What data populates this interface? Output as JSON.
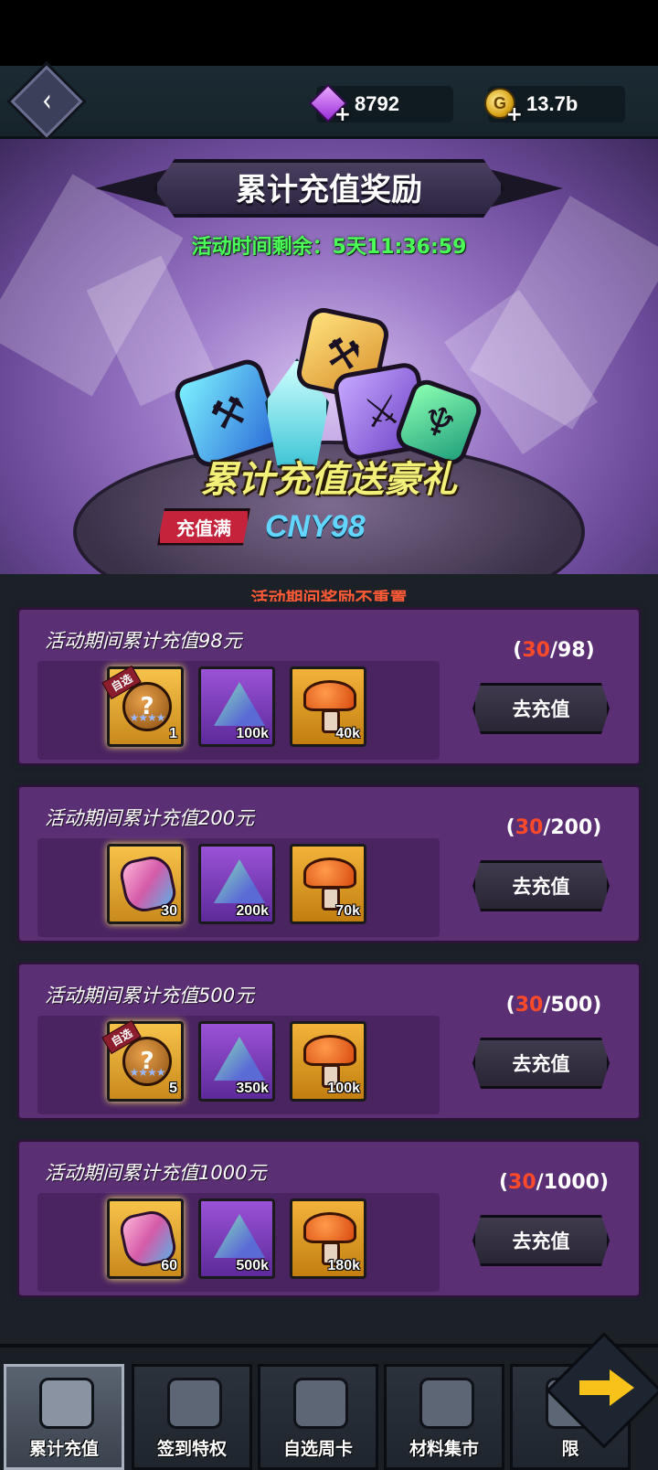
{
  "currencies": {
    "gems": "8792",
    "gold": "13.7b",
    "gold_symbol": "G"
  },
  "banner": {
    "title": "累计充值奖励",
    "countdown_label": "活动时间剩余：",
    "countdown_value": "5天11:36:59",
    "promo": "累计充值送豪礼",
    "threshold_tag": "充值满",
    "threshold_value": "CNY98"
  },
  "notice": "活动期间奖励不重置",
  "tiers": [
    {
      "title": "活动期间累计充值98元",
      "progress_current": "30",
      "progress_target": "/98",
      "button": "去充值",
      "rewards": [
        {
          "type": "chest",
          "qty": "1",
          "selectable": "自选",
          "stars": "★★★★"
        },
        {
          "type": "powder",
          "qty": "100k"
        },
        {
          "type": "mushroom",
          "qty": "40k"
        }
      ]
    },
    {
      "title": "活动期间累计充值200元",
      "progress_current": "30",
      "progress_target": "/200",
      "button": "去充值",
      "rewards": [
        {
          "type": "fist",
          "qty": "30"
        },
        {
          "type": "powder",
          "qty": "200k"
        },
        {
          "type": "mushroom",
          "qty": "70k"
        }
      ]
    },
    {
      "title": "活动期间累计充值500元",
      "progress_current": "30",
      "progress_target": "/500",
      "button": "去充值",
      "rewards": [
        {
          "type": "chest",
          "qty": "5",
          "selectable": "自选",
          "stars": "★★★★"
        },
        {
          "type": "powder",
          "qty": "350k"
        },
        {
          "type": "mushroom",
          "qty": "100k"
        }
      ]
    },
    {
      "title": "活动期间累计充值1000元",
      "progress_current": "30",
      "progress_target": "/1000",
      "button": "去充值",
      "rewards": [
        {
          "type": "fist",
          "qty": "60"
        },
        {
          "type": "powder",
          "qty": "500k"
        },
        {
          "type": "mushroom",
          "qty": "180k"
        }
      ]
    }
  ],
  "tabs": [
    {
      "label": "累计充值",
      "icon": "shield-icon",
      "active": true
    },
    {
      "label": "签到特权",
      "icon": "bell-icon",
      "active": false
    },
    {
      "label": "自选周卡",
      "icon": "gift-box-icon",
      "active": false
    },
    {
      "label": "材料集市",
      "icon": "discount-tag-icon",
      "active": false
    },
    {
      "label": "限",
      "icon": "limited-icon",
      "active": false
    }
  ],
  "accent_colors": {
    "countdown": "#4cff58",
    "notice": "#ff5a36",
    "progress_current": "#ff4a2a",
    "card_bg": "#5b2f74"
  }
}
